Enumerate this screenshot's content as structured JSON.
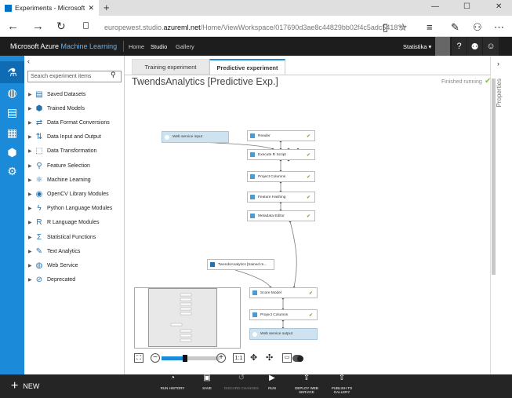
{
  "browser": {
    "tab_title": "Experiments - Microsoft",
    "tab_close": "✕",
    "new_tab": "+",
    "url_prefix": "europewest.studio.",
    "url_domain": "azureml.net",
    "url_path": "/Home/ViewWorkspace/017690d3ae8c44829bb02f4c5adc5418?#"
  },
  "header": {
    "brand_ms": "Microsoft Azure ",
    "brand_ml": "Machine Learning",
    "nav": [
      "Home",
      "Studio",
      "Gallery"
    ],
    "user": "Statistika ▾"
  },
  "palette": {
    "search_placeholder": "Search experiment items",
    "items": [
      {
        "label": "Saved Datasets",
        "icon": "dataset-icon"
      },
      {
        "label": "Trained Models",
        "icon": "cube-icon"
      },
      {
        "label": "Data Format Conversions",
        "icon": "conversion-icon"
      },
      {
        "label": "Data Input and Output",
        "icon": "input-output-icon"
      },
      {
        "label": "Data Transformation",
        "icon": "transform-icon"
      },
      {
        "label": "Feature Selection",
        "icon": "magnifier-icon"
      },
      {
        "label": "Machine Learning",
        "icon": "ml-icon"
      },
      {
        "label": "OpenCV Library Modules",
        "icon": "opencv-icon"
      },
      {
        "label": "Python Language Modules",
        "icon": "python-icon"
      },
      {
        "label": "R Language Modules",
        "icon": "r-icon"
      },
      {
        "label": "Statistical Functions",
        "icon": "sigma-icon"
      },
      {
        "label": "Text Analytics",
        "icon": "text-analytics-icon"
      },
      {
        "label": "Web Service",
        "icon": "globe-icon"
      },
      {
        "label": "Deprecated",
        "icon": "deprecated-icon"
      }
    ]
  },
  "experiment": {
    "tabs": [
      "Training experiment",
      "Predictive experiment"
    ],
    "active_tab": 1,
    "title": "TwendsAnalytics [Predictive Exp.]",
    "status": "Finished running",
    "modules": {
      "web_input": "Web service input",
      "reader": "Reader",
      "execute_r": "Execute R Script",
      "project_columns_1": "Project Columns",
      "feature_hashing": "Feature Hashing",
      "metadata_editor": "Metadata Editor",
      "trained_model": "TwendsAnalytics [trained m...",
      "score_model": "Score Model",
      "project_columns_2": "Project Columns",
      "web_output": "Web service output"
    },
    "zoom_ratio": "1:1",
    "zoom_level": 0.4
  },
  "right_panel": {
    "label": "Properties"
  },
  "bottom": {
    "new": "NEW",
    "commands": [
      {
        "label": "RUN HISTORY",
        "icon": "clock-icon",
        "enabled": true
      },
      {
        "label": "SAVE",
        "icon": "save-icon",
        "enabled": true
      },
      {
        "label": "DISCARD CHANGES",
        "icon": "discard-icon",
        "enabled": false
      },
      {
        "label": "RUN",
        "icon": "play-icon",
        "enabled": true
      },
      {
        "label": "DEPLOY WEB SERVICE",
        "icon": "deploy-icon",
        "enabled": true
      },
      {
        "label": "PUBLISH TO GALLERY",
        "icon": "publish-icon",
        "enabled": true
      }
    ]
  },
  "colors": {
    "accent": "#1b8ad8",
    "header_bg": "#1d1d1d",
    "bottom_bg": "#252525",
    "success": "#8bc34a"
  }
}
